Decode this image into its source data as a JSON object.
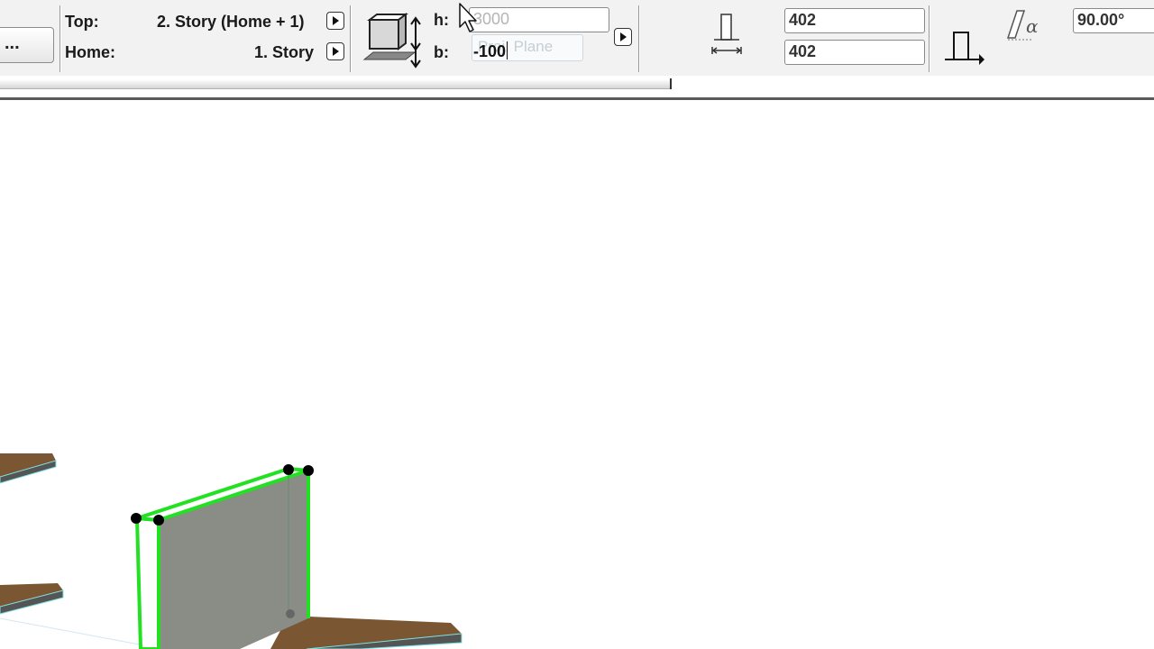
{
  "story_panel": {
    "more_button": "...",
    "top_label": "Top:",
    "top_value": "2. Story (Home + 1)",
    "home_label": "Home:",
    "home_value": "1. Story"
  },
  "elevation_panel": {
    "h_label": "h:",
    "h_value": "3000",
    "b_label": "b:",
    "b_value": "-100",
    "tooltip": "Proj. Plane"
  },
  "thickness_panel": {
    "top_value": "402",
    "bottom_value": "402"
  },
  "angle_panel": {
    "angle_value": "90.00°"
  },
  "icons": [
    "element-height-icon",
    "expand-arrow-icon",
    "wall-thickness-icon",
    "wall-profile-icon",
    "slant-angle-icon",
    "mouse-cursor-icon"
  ],
  "colors": {
    "selection_highlight": "#22e022",
    "floor_slab": "#7a5632",
    "wall_face": "#8a8c86"
  }
}
